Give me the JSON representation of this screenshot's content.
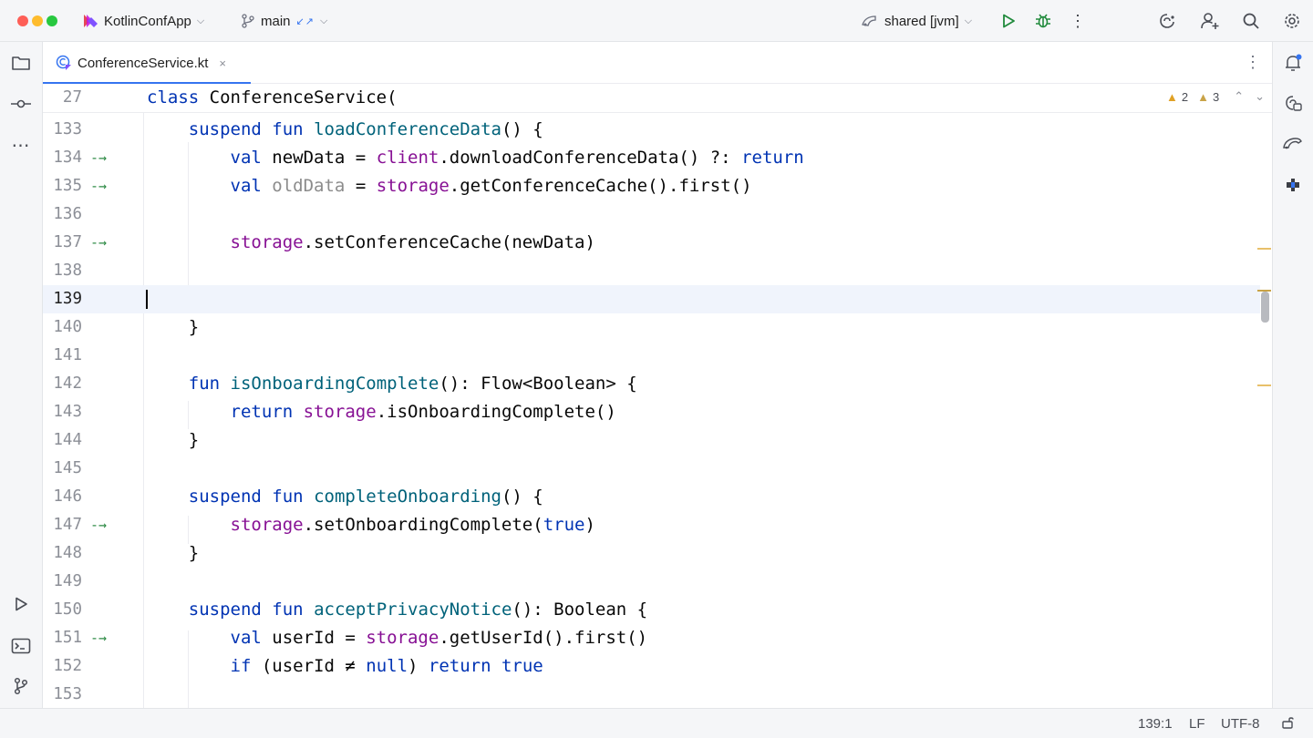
{
  "titlebar": {
    "project": "KotlinConfApp",
    "branch": "main",
    "run_config": "shared [jvm]",
    "icons": [
      "run-icon",
      "debug-icon",
      "more-vertical-icon",
      "ai-assistant-icon",
      "add-user-icon",
      "search-icon",
      "settings-icon"
    ]
  },
  "tab": {
    "file_name": "ConferenceService.kt",
    "close_symbol": "×"
  },
  "inspections": {
    "warnings": "2",
    "weak_warnings": "3"
  },
  "sticky": {
    "line": "27",
    "code": "class ConferenceService("
  },
  "lines": [
    {
      "n": "133",
      "text": "suspend fun loadConferenceData() {"
    },
    {
      "n": "134",
      "text": "val newData = client.downloadConferenceData() ?: return"
    },
    {
      "n": "135",
      "text": "val oldData = storage.getConferenceCache().first()"
    },
    {
      "n": "136",
      "text": ""
    },
    {
      "n": "137",
      "text": "storage.setConferenceCache(newData)"
    },
    {
      "n": "138",
      "text": ""
    },
    {
      "n": "139",
      "text": ""
    },
    {
      "n": "140",
      "text": "}"
    },
    {
      "n": "141",
      "text": ""
    },
    {
      "n": "142",
      "text": "fun isOnboardingComplete(): Flow<Boolean> {"
    },
    {
      "n": "143",
      "text": "return storage.isOnboardingComplete()"
    },
    {
      "n": "144",
      "text": "}"
    },
    {
      "n": "145",
      "text": ""
    },
    {
      "n": "146",
      "text": "suspend fun completeOnboarding() {"
    },
    {
      "n": "147",
      "text": "storage.setOnboardingComplete(true)"
    },
    {
      "n": "148",
      "text": "}"
    },
    {
      "n": "149",
      "text": ""
    },
    {
      "n": "150",
      "text": "suspend fun acceptPrivacyNotice(): Boolean {"
    },
    {
      "n": "151",
      "text": "val userId = storage.getUserId().first()"
    },
    {
      "n": "152",
      "text": "if (userId ≠ null) return true"
    },
    {
      "n": "153",
      "text": ""
    }
  ],
  "impl_marker": "-→",
  "statusbar": {
    "position": "139:1",
    "line_separator": "LF",
    "encoding": "UTF-8"
  },
  "colors": {
    "keyword": "#0033b3",
    "function": "#00627a",
    "property": "#871094",
    "accent": "#3574f0",
    "current_line": "#f0f4fc"
  }
}
